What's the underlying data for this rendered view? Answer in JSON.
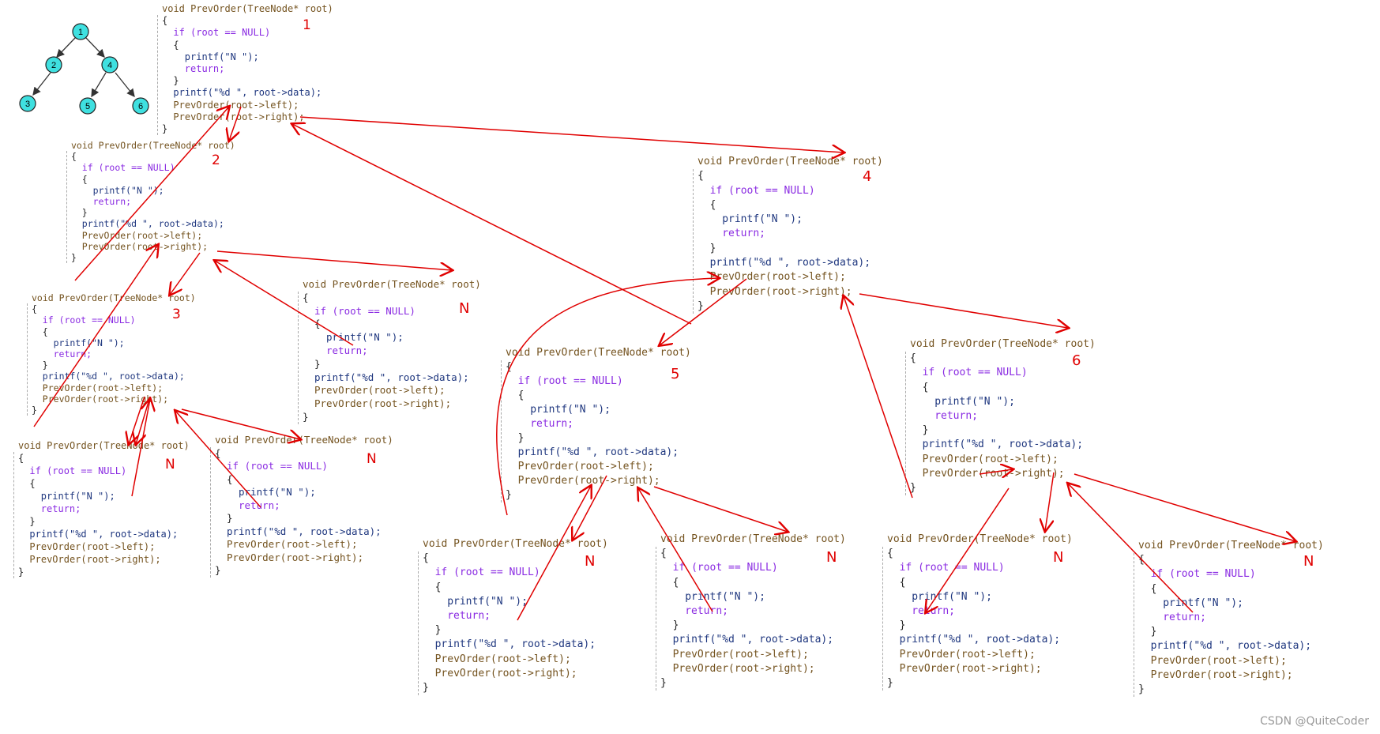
{
  "tree": {
    "nodes": [
      "1",
      "2",
      "4",
      "3",
      "5",
      "6"
    ]
  },
  "code": {
    "l1": "void PrevOrder(TreeNode* root)",
    "l2": "{",
    "l3": "if (root == NULL)",
    "l4": "{",
    "l5": "printf(\"N \");",
    "l6": "return;",
    "l7": "}",
    "l8": "printf(\"%d \", root->data);",
    "l9": "PrevOrder(root->left);",
    "l10": "PrevOrder(root->right);",
    "l11": "}"
  },
  "labels": {
    "s1": "1",
    "s2": "2",
    "s3": "3",
    "s4": "4",
    "s5": "5",
    "s6": "6",
    "n": "N"
  },
  "watermark": "CSDN @QuiteCoder",
  "colors": {
    "annotation": "#e00000",
    "node_fill": "#3fe0e0"
  }
}
